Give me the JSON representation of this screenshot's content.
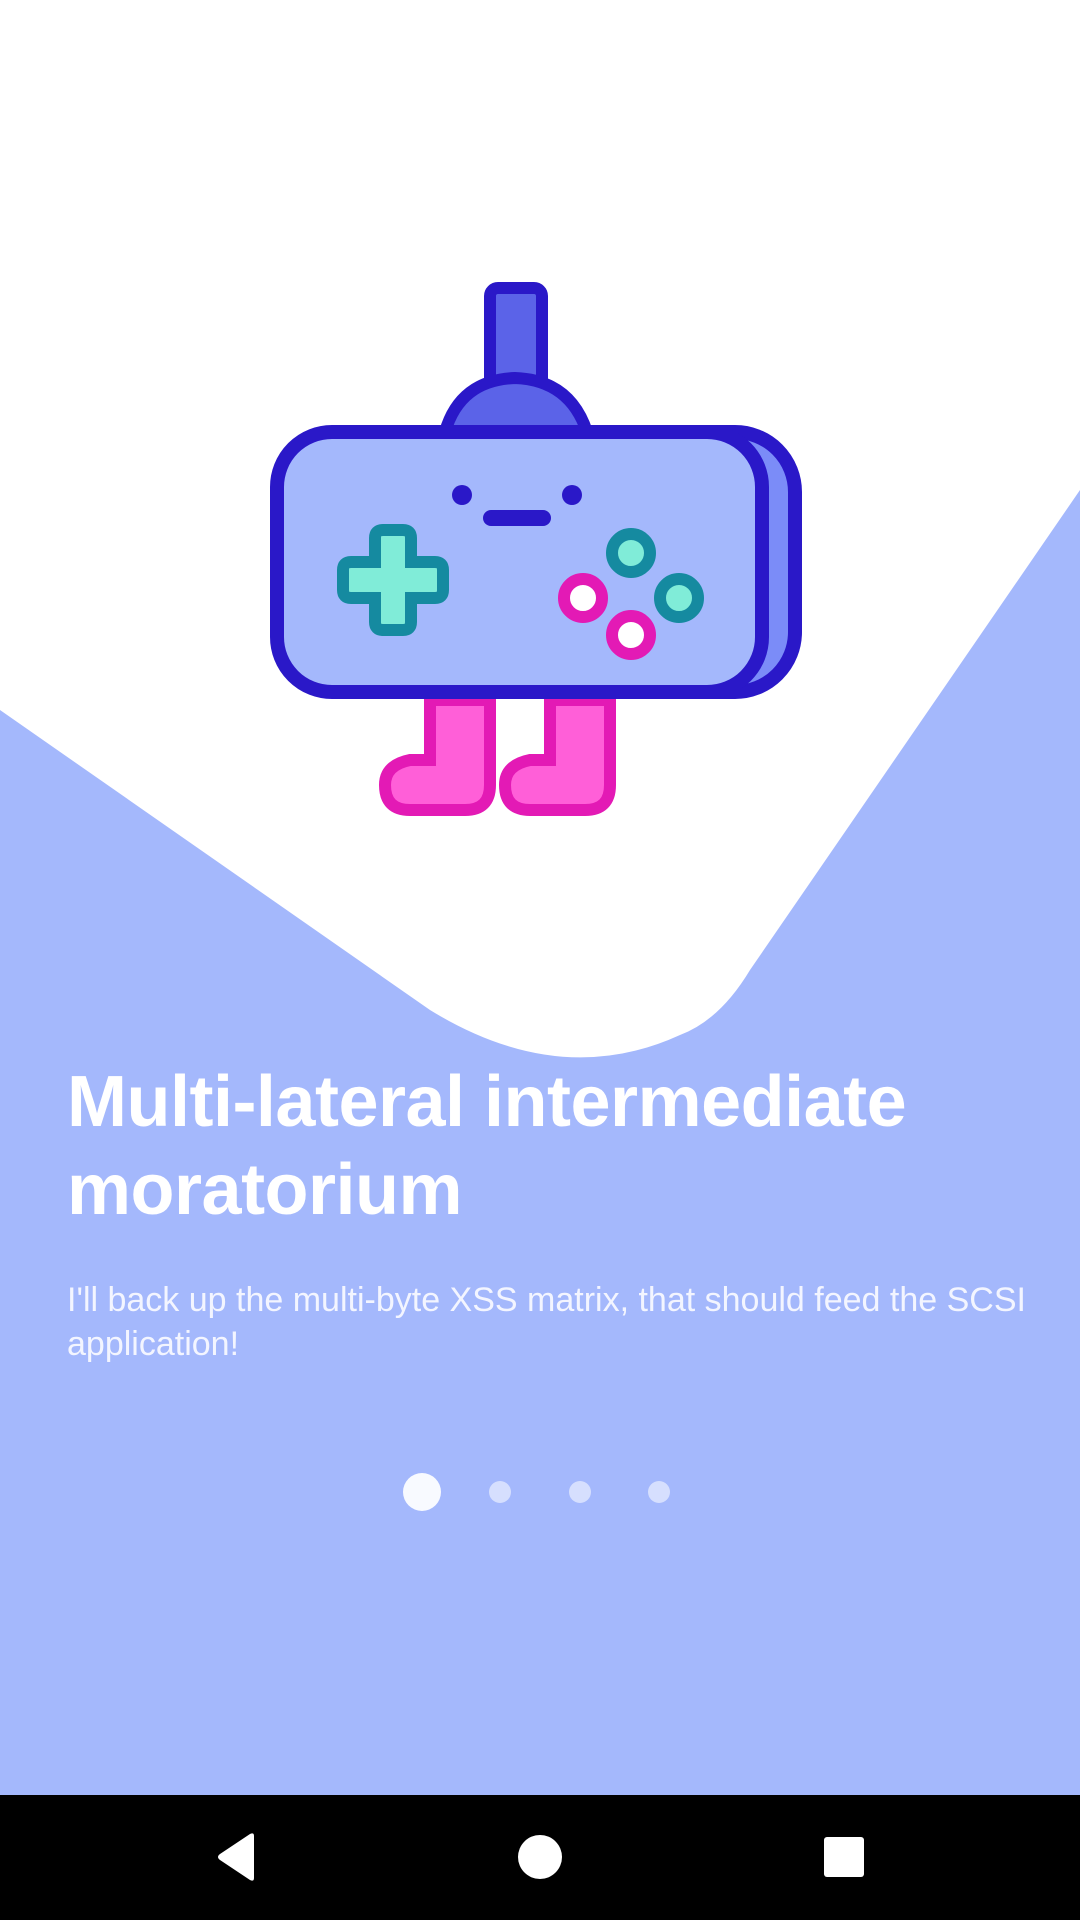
{
  "onboarding": {
    "title": "Multi-lateral intermediate moratorium",
    "subtitle": "I'll back up the multi-byte XSS matrix, that should feed the SCSI application!",
    "illustration_icon": "gamepad-robot-icon",
    "page_indicator": {
      "total": 4,
      "active_index": 0
    }
  },
  "colors": {
    "background_top": "#ffffff",
    "background_panel": "#a4b8fc",
    "text": "#ffffff",
    "navbar": "#000000"
  },
  "system_nav": {
    "back_icon": "back-triangle-icon",
    "home_icon": "home-circle-icon",
    "recents_icon": "recents-square-icon"
  }
}
